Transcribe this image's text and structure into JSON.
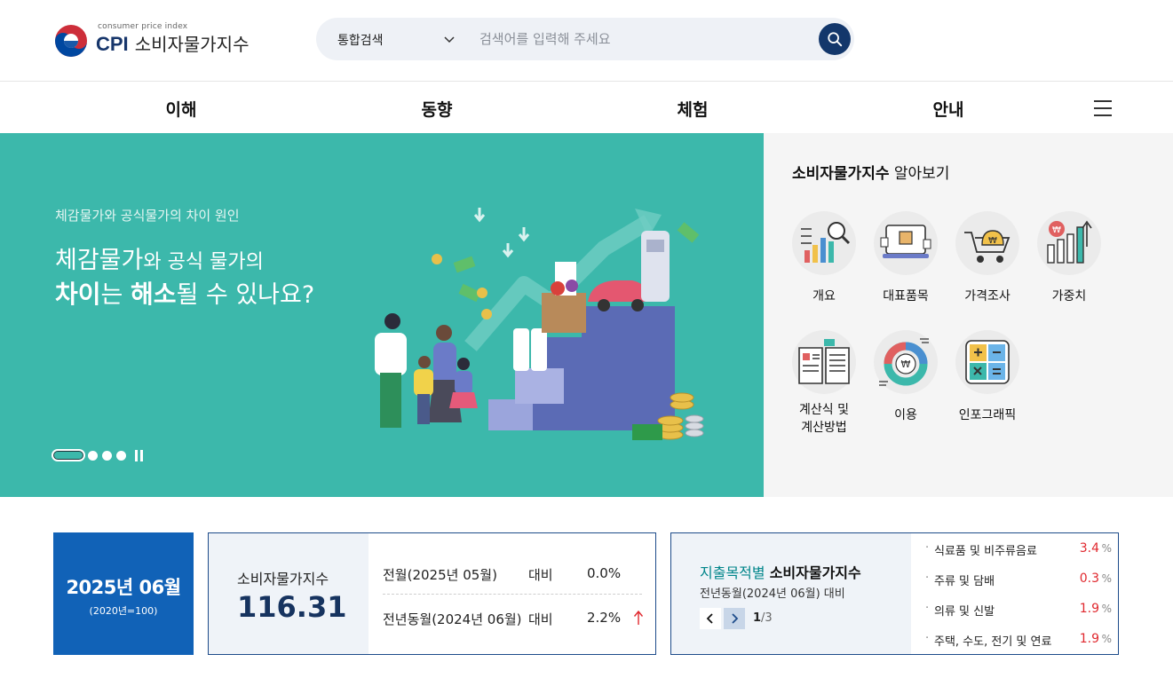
{
  "header": {
    "logo": {
      "small_text": "consumer price index",
      "brand": "CPI",
      "name": "소비자물가지수"
    },
    "search": {
      "scope_label": "통합검색",
      "placeholder": "검색어를 입력해 주세요"
    }
  },
  "nav": {
    "items": [
      "이해",
      "동향",
      "체험",
      "안내"
    ]
  },
  "hero": {
    "subtitle": "체감물가와 공식물가의 차이 원인",
    "headline_line1_a": "체감물가",
    "headline_line1_b": "와 공식 물가",
    "headline_line1_c": "의",
    "headline_line2_a": "차이",
    "headline_line2_b": "는 ",
    "headline_line2_c": "해소",
    "headline_line2_d": "될 수 있나요?",
    "background_color": "#3cb8ab",
    "slides_total": 4,
    "slide_active": 1
  },
  "side_panel": {
    "title_bold": "소비자물가지수",
    "title_rest": "알아보기",
    "tiles": [
      {
        "label": "개요",
        "icon": "overview-chart-icon"
      },
      {
        "label": "대표품목",
        "icon": "representative-items-icon"
      },
      {
        "label": "가격조사",
        "icon": "price-survey-cart-icon"
      },
      {
        "label": "가중치",
        "icon": "weight-bar-chart-icon"
      },
      {
        "label": "계산식 및\n계산방법",
        "icon": "calculation-book-icon"
      },
      {
        "label": "이용",
        "icon": "usage-donut-icon"
      },
      {
        "label": "인포그래픽",
        "icon": "infographic-calculator-icon"
      }
    ]
  },
  "stats": {
    "date": "2025년 06월",
    "base_year": "(2020년=100)",
    "cpi_label": "소비자물가지수",
    "cpi_value": "116.31",
    "compare_rows": [
      {
        "label": "전월(2025년 05월)",
        "cmp": "대비",
        "value": "0.0%"
      },
      {
        "label": "전년동월(2024년 06월)",
        "cmp": "대비",
        "value": "2.2%",
        "trend": "up"
      }
    ],
    "up_color": "#e0282e"
  },
  "expenditure": {
    "title_highlight": "지출목적별",
    "title_rest": "소비자물가지수",
    "subtitle": "전년동월(2024년 06월) 대비",
    "page_current": "1",
    "page_total": "/3",
    "items": [
      {
        "name": "식료품 및 비주류음료",
        "value": "3.4",
        "unit": "%"
      },
      {
        "name": "주류 및 담배",
        "value": "0.3",
        "unit": "%"
      },
      {
        "name": "의류 및 신발",
        "value": "1.9",
        "unit": "%"
      },
      {
        "name": "주택, 수도, 전기 및 연료",
        "value": "1.9",
        "unit": "%"
      }
    ]
  }
}
